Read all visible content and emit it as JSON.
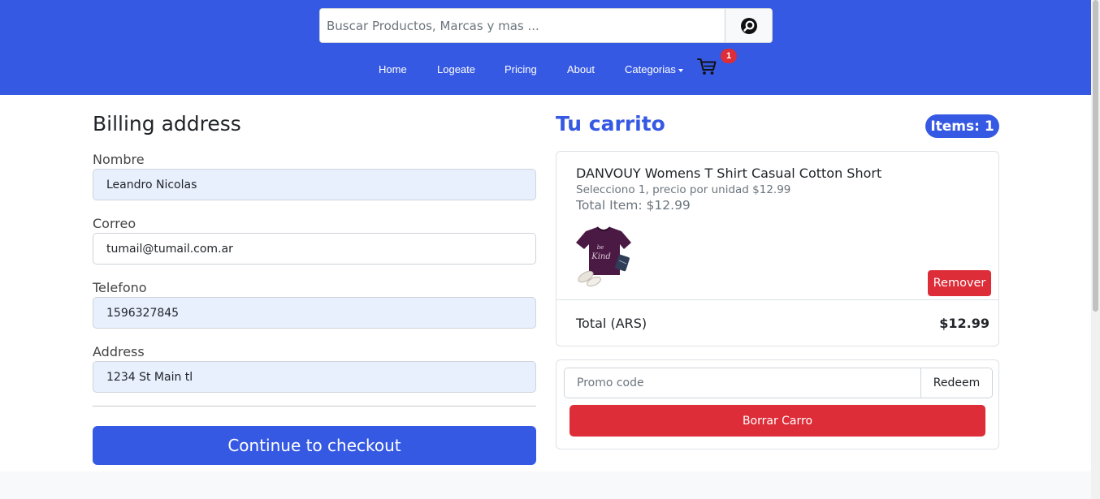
{
  "header": {
    "search": {
      "placeholder": "Buscar Productos, Marcas y mas ..."
    },
    "nav": [
      {
        "label": "Home"
      },
      {
        "label": "Logeate"
      },
      {
        "label": "Pricing"
      },
      {
        "label": "About"
      },
      {
        "label": "Categorias"
      }
    ],
    "cart_count": "1",
    "icons": {
      "search": "search-icon",
      "cart": "cart-icon",
      "dropdown": "caret-down-icon"
    },
    "background": "#3659e3"
  },
  "billing": {
    "title": "Billing address",
    "fields": [
      {
        "label": "Nombre",
        "value": "Leandro Nicolas",
        "autofilled": true
      },
      {
        "label": "Correo",
        "value": "tumail@tumail.com.ar",
        "autofilled": false
      },
      {
        "label": "Telefono",
        "value": "1596327845",
        "autofilled": true
      },
      {
        "label": "Address",
        "value": "1234 St Main tl",
        "autofilled": true
      }
    ],
    "checkout_label": "Continue to checkout"
  },
  "cart": {
    "title": "Tu carrito",
    "items_badge": "Items: 1",
    "items": [
      {
        "name": "DANVOUY Womens T Shirt Casual Cotton Short",
        "selection": "Selecciono 1, precio por unidad $12.99",
        "total": "Total Item: $12.99",
        "remove_label": "Remover"
      }
    ],
    "total_label": "Total (ARS)",
    "total_value": "$12.99",
    "promo": {
      "placeholder": "Promo code",
      "redeem_label": "Redeem"
    },
    "clear_label": "Borrar Carro"
  },
  "colors": {
    "primary": "#3659e3",
    "danger": "#dc2d39",
    "autofill": "#e8f0fe"
  }
}
